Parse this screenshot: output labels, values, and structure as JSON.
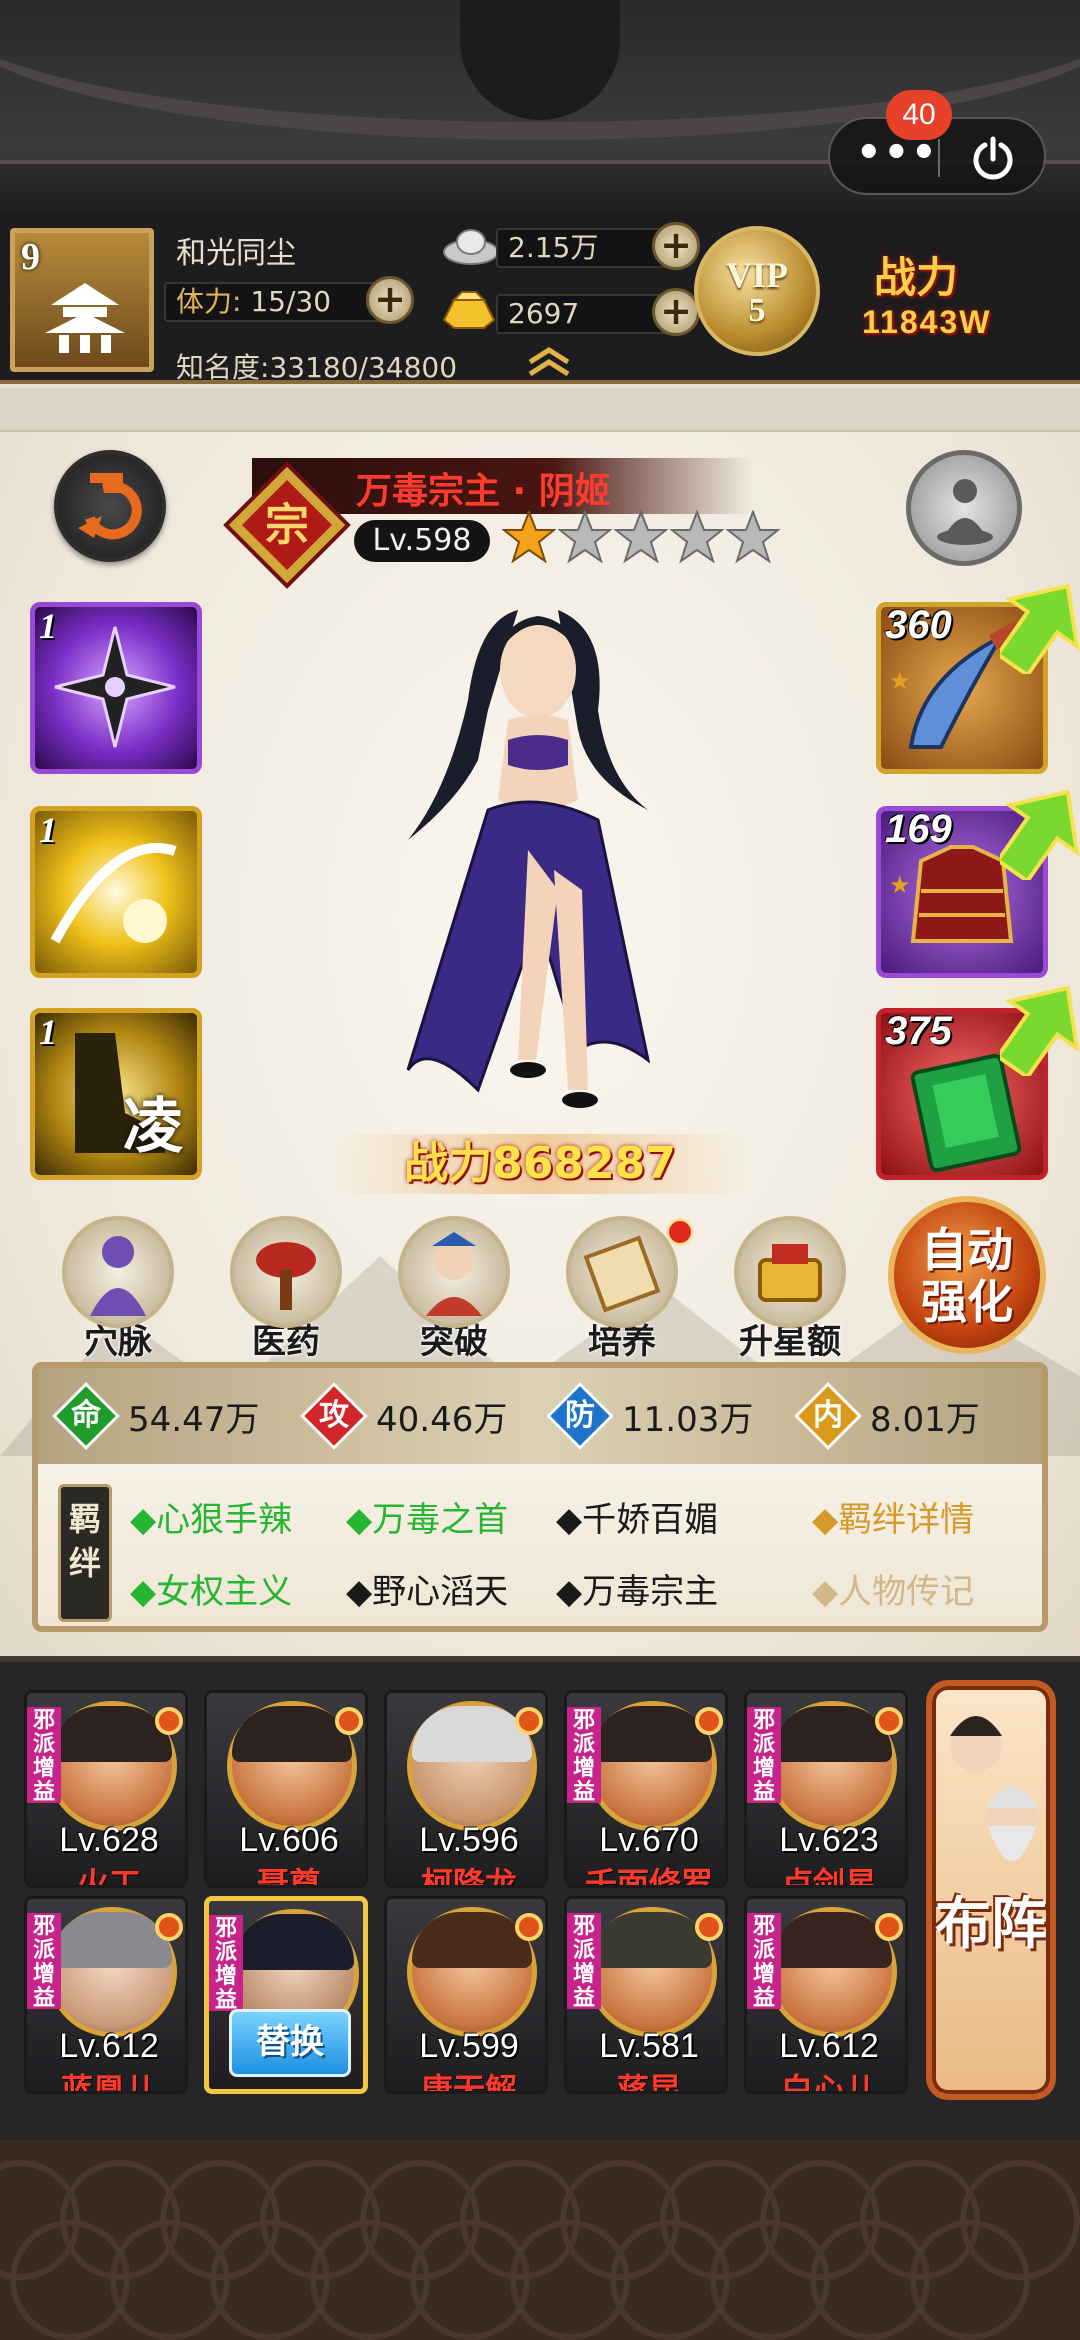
{
  "capsule": {
    "more_label": "•••",
    "notification_count": "40"
  },
  "player": {
    "level": "9",
    "name": "和光同尘",
    "stamina_label": "体力:",
    "stamina": "15/30",
    "fame_label": "知名度:",
    "fame": "33180/34800",
    "silver": "2.15万",
    "gold": "2697",
    "vip_label": "VIP",
    "vip_level": "5",
    "power_label": "战力",
    "power_value": "11843W"
  },
  "hero": {
    "name": "万毒宗主 · 阴姬",
    "rank_glyph": "宗",
    "level": "Lv.598",
    "stars_filled": 1,
    "stars_total": 5,
    "power": "战力868287",
    "skills": [
      {
        "level": "1",
        "icon": "shuriken-icon"
      },
      {
        "level": "1",
        "icon": "golden-light-icon"
      },
      {
        "level": "1",
        "icon": "swift-boot-icon",
        "glyph": "凌"
      }
    ],
    "equipment": [
      {
        "level": "360",
        "icon": "curved-blade-icon"
      },
      {
        "level": "169",
        "icon": "armor-icon"
      },
      {
        "level": "375",
        "icon": "book-icon"
      }
    ]
  },
  "functions": [
    {
      "label": "穴脉",
      "icon": "meridian-icon",
      "dot": false
    },
    {
      "label": "医药",
      "icon": "herb-icon",
      "dot": false
    },
    {
      "label": "突破",
      "icon": "breakthrough-icon",
      "dot": false
    },
    {
      "label": "培养",
      "icon": "scroll-icon",
      "dot": true
    },
    {
      "label": "升星额外",
      "icon": "star-up-icon",
      "dot": false
    }
  ],
  "auto_enhance": {
    "line1": "自动",
    "line2": "强化"
  },
  "stats": [
    {
      "glyph": "命",
      "value": "54.47万",
      "color": "#1f9c2a"
    },
    {
      "glyph": "攻",
      "value": "40.46万",
      "color": "#d2262a"
    },
    {
      "glyph": "防",
      "value": "11.03万",
      "color": "#1e74c8"
    },
    {
      "glyph": "内",
      "value": "8.01万",
      "color": "#d99a1b"
    }
  ],
  "bonds": {
    "tag": "羁绊",
    "items": [
      {
        "text": "◆心狠手辣",
        "active": true
      },
      {
        "text": "◆万毒之首",
        "active": true
      },
      {
        "text": "◆千娇百媚",
        "active": false
      },
      {
        "text": "◆女权主义",
        "active": true
      },
      {
        "text": "◆野心滔天",
        "active": false
      },
      {
        "text": "◆万毒宗主",
        "active": false
      }
    ],
    "detail_link": "◆羁绊详情",
    "bio_link": "◆人物传记"
  },
  "team": {
    "badge_text": "邪派增益",
    "swap_label": "替换",
    "formation_label": "布阵",
    "members": [
      {
        "level": "Lv.628",
        "name": "火工",
        "badge": true
      },
      {
        "level": "Lv.606",
        "name": "聂尊",
        "badge": false
      },
      {
        "level": "Lv.596",
        "name": "柯降龙",
        "badge": false
      },
      {
        "level": "Lv.670",
        "name": "千面修罗",
        "badge": true
      },
      {
        "level": "Lv.623",
        "name": "卢剑星",
        "badge": true
      },
      {
        "level": "Lv.612",
        "name": "蓝凰儿",
        "badge": true
      },
      {
        "level": "",
        "name": "",
        "badge": true,
        "selected": true
      },
      {
        "level": "Lv.599",
        "name": "唐无解",
        "badge": false
      },
      {
        "level": "Lv.581",
        "name": "蒋昆",
        "badge": true
      },
      {
        "level": "Lv.612",
        "name": "白心儿",
        "badge": true
      }
    ]
  }
}
